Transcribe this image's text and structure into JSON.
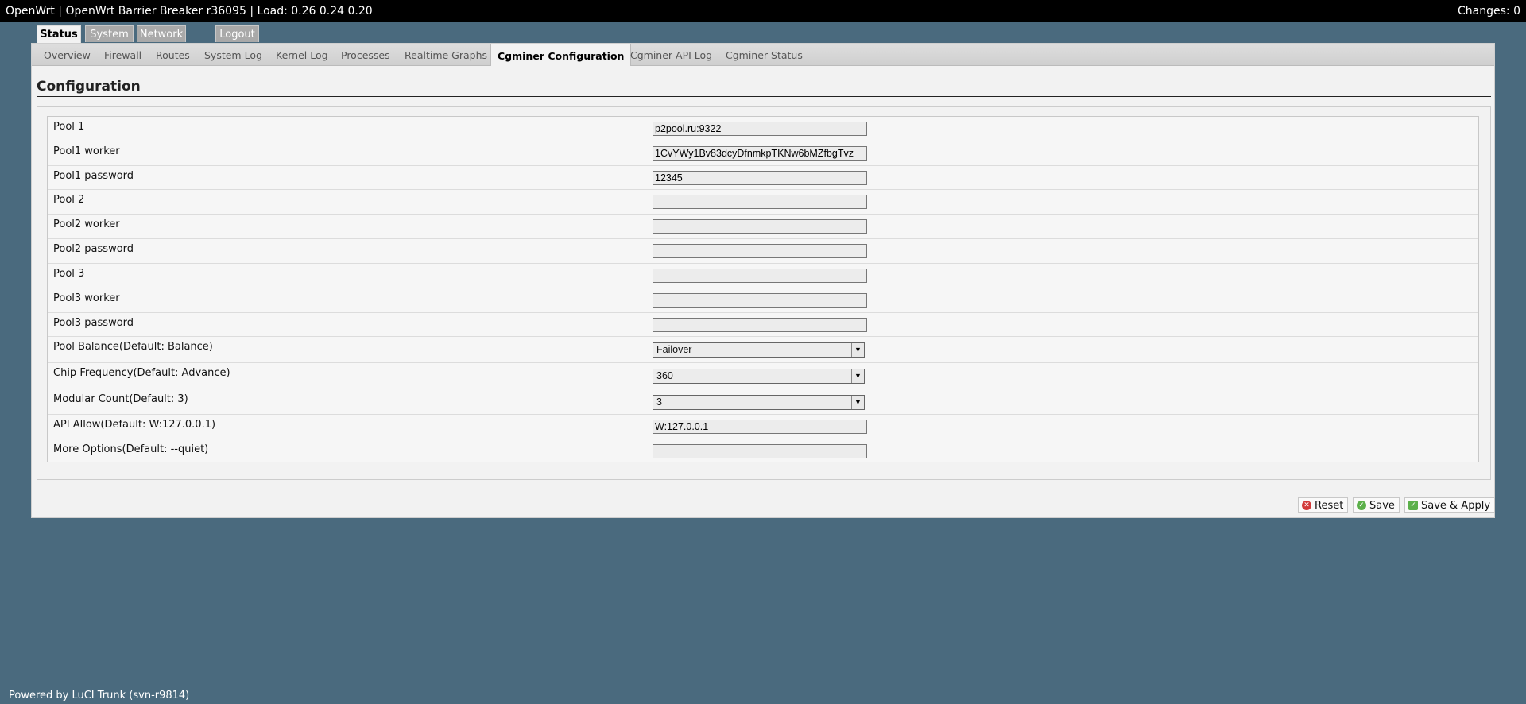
{
  "header": {
    "title": "OpenWrt | OpenWrt Barrier Breaker r36095 | Load: 0.26 0.24 0.20",
    "changes": "Changes: 0"
  },
  "main_tabs": [
    "Status",
    "System",
    "Network",
    "Logout"
  ],
  "sub_tabs": [
    "Overview",
    "Firewall",
    "Routes",
    "System Log",
    "Kernel Log",
    "Processes",
    "Realtime Graphs",
    "Cgminer Configuration",
    "Cgminer API Log",
    "Cgminer Status"
  ],
  "page": {
    "title": "Configuration"
  },
  "fields": [
    {
      "label": "Pool 1",
      "value": "p2pool.ru:9322"
    },
    {
      "label": "Pool1 worker",
      "value": "1CvYWy1Bv83dcyDfnmkpTKNw6bMZfbgTvz"
    },
    {
      "label": "Pool1 password",
      "value": "12345"
    },
    {
      "label": "Pool 2",
      "value": ""
    },
    {
      "label": "Pool2 worker",
      "value": ""
    },
    {
      "label": "Pool2 password",
      "value": ""
    },
    {
      "label": "Pool 3",
      "value": ""
    },
    {
      "label": "Pool3 worker",
      "value": ""
    },
    {
      "label": "Pool3 password",
      "value": ""
    },
    {
      "label": "Pool Balance(Default: Balance)",
      "value": "Failover"
    },
    {
      "label": "Chip Frequency(Default: Advance)",
      "value": "360"
    },
    {
      "label": "Modular Count(Default: 3)",
      "value": "3"
    },
    {
      "label": "API Allow(Default: W:127.0.0.1)",
      "value": "W:127.0.0.1"
    },
    {
      "label": "More Options(Default: --quiet)",
      "value": ""
    }
  ],
  "actions": {
    "reset": "Reset",
    "save": "Save",
    "save_apply": "Save & Apply"
  },
  "footer": "Powered by LuCI Trunk (svn-r9814)"
}
